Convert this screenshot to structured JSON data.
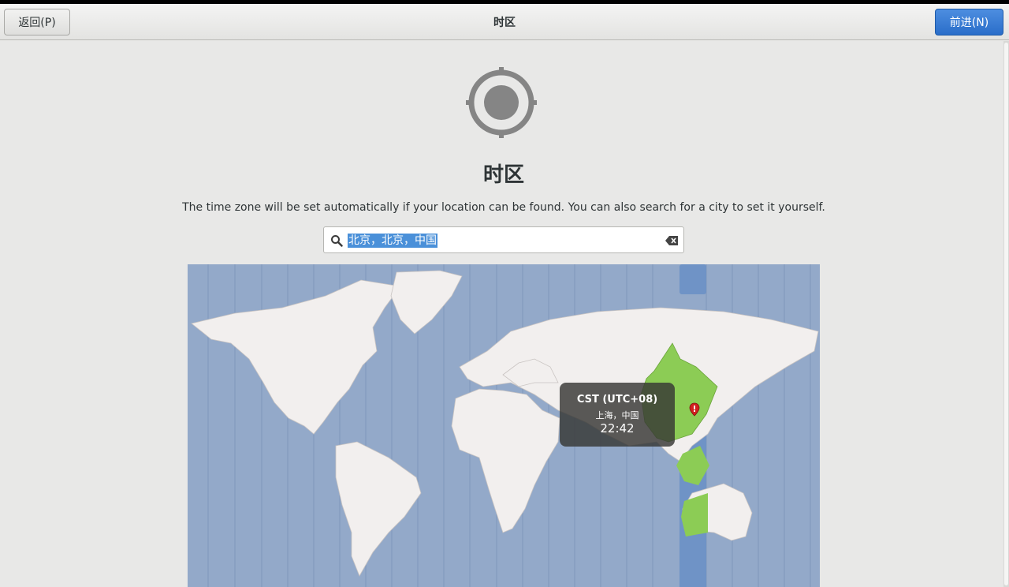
{
  "header": {
    "title": "时区",
    "back_label": "返回(P)",
    "next_label": "前进(N)"
  },
  "main": {
    "title": "时区",
    "description": "The time zone will be set automatically if your location can be found. You can also search for a city to set it yourself.",
    "search": {
      "value": "北京，北京，中国"
    }
  },
  "map": {
    "tooltip": {
      "zone": "CST (UTC+08)",
      "city": "上海，中国",
      "time": "22:42"
    }
  },
  "icons": {
    "location": "location-crosshair-icon",
    "search": "search-icon",
    "clear": "clear-icon",
    "pin": "map-pin-icon"
  },
  "colors": {
    "accent": "#2a6ec9",
    "selection": "#4a90d9",
    "ocean": "#93a9c9",
    "highlight_zone": "#6f93c6",
    "land": "#f2efee",
    "selected_land": "#8ccc55",
    "pin": "#d21f1f"
  }
}
